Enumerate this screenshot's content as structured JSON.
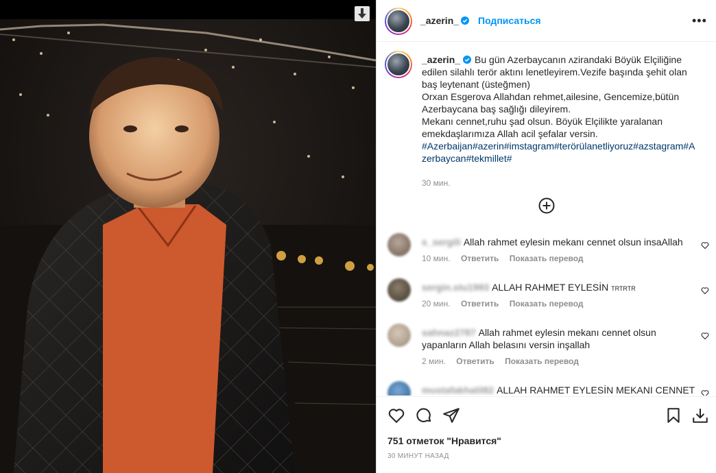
{
  "post": {
    "author": "_azerin_",
    "follow_label": "Подписаться",
    "more_label": "•••",
    "caption_lines": [
      "Bu gün Azerbaycanın ʌzirandaki Böyük Elçiliğine",
      "edilen silahlı terör aktını lenetleyirem.Vezife başında şehit olan",
      "baş leytenant (üsteğmen)",
      "Orxan Esgerova Allahdan rehmet,ailesine, Gencemize,bütün",
      "Azerbaycana baş sağlığı dileyirem.",
      "Mekanı cennet,ruhu şad olsun. Böyük Elçilikte yaralanan",
      "emekdaşlarımıza Allah acil şefalar versin."
    ],
    "hashtag_lines": [
      "#Azerbaijan#azerin#imstagram#terörülanetliyoruz#azstagram#A",
      "zerbaycan#tekmillet#"
    ],
    "caption_time": "30 мин.",
    "likes_text": "751 отметок \"Нравится\"",
    "posted_ago": "30 минут назад"
  },
  "comments": [
    {
      "user": "s_sergili",
      "text": "Allah rahmet eylesin mekanı cennet olsun insaAllah",
      "tail": "",
      "time": "10 мин.",
      "reply": "Ответить",
      "translate": "Показать перевод"
    },
    {
      "user": "sergin.stu1993",
      "text": "ALLAH RAHMET EYLESİN",
      "tail": "TRTRTR",
      "time": "20 мин.",
      "reply": "Ответить",
      "translate": "Показать перевод"
    },
    {
      "user": "sahnaz2787",
      "text": "Allah rahmet eylesin mekanı cennet olsun",
      "text2": "yapanların Allah belasını versin inşallah",
      "tail": "",
      "time": "2 мин.",
      "reply": "Ответить",
      "translate": "Показать перевод"
    },
    {
      "user": "mustafakhalil82",
      "text": "ALLAH RAHMET EYLESİN MEKANI CENNET",
      "tail": "",
      "time": "",
      "reply": "",
      "translate": ""
    }
  ],
  "icons": {
    "download": "download-arrow-icon",
    "verified": "verified-badge-icon",
    "load_more": "plus-circle-icon",
    "like": "heart-icon",
    "comment": "comment-bubble-icon",
    "share": "paper-plane-icon",
    "save": "bookmark-icon",
    "download_post": "download-icon"
  },
  "colors": {
    "accent": "#0095f6",
    "hashtag": "#00376b",
    "muted": "#8e8e8e",
    "text": "#262626"
  }
}
